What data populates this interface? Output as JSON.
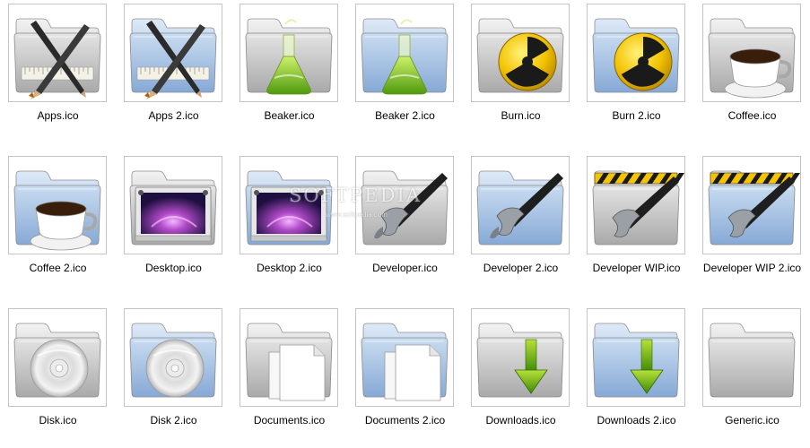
{
  "watermark": {
    "title": "SOFTPEDIA",
    "url": "www.softpedia.com"
  },
  "files": [
    {
      "label": "Apps.ico",
      "folder": "gray",
      "icon": "pencil-ruler-icon"
    },
    {
      "label": "Apps 2.ico",
      "folder": "blue",
      "icon": "pencil-ruler-icon"
    },
    {
      "label": "Beaker.ico",
      "folder": "gray",
      "icon": "beaker-icon"
    },
    {
      "label": "Beaker 2.ico",
      "folder": "blue",
      "icon": "beaker-icon"
    },
    {
      "label": "Burn.ico",
      "folder": "gray",
      "icon": "radiation-icon"
    },
    {
      "label": "Burn 2.ico",
      "folder": "blue",
      "icon": "radiation-icon"
    },
    {
      "label": "Coffee.ico",
      "folder": "gray",
      "icon": "coffee-cup-icon"
    },
    {
      "label": "Coffee 2.ico",
      "folder": "blue",
      "icon": "coffee-cup-icon"
    },
    {
      "label": "Desktop.ico",
      "folder": "gray",
      "icon": "desktop-picture-icon"
    },
    {
      "label": "Desktop 2.ico",
      "folder": "blue",
      "icon": "desktop-picture-icon"
    },
    {
      "label": "Developer.ico",
      "folder": "gray",
      "icon": "hammer-icon"
    },
    {
      "label": "Developer 2.ico",
      "folder": "blue",
      "icon": "hammer-icon"
    },
    {
      "label": "Developer WIP.ico",
      "folder": "gray",
      "icon": "hammer-wip-icon"
    },
    {
      "label": "Developer WIP 2.ico",
      "folder": "blue",
      "icon": "hammer-wip-icon"
    },
    {
      "label": "Disk.ico",
      "folder": "gray",
      "icon": "disc-icon"
    },
    {
      "label": "Disk 2.ico",
      "folder": "blue",
      "icon": "disc-icon"
    },
    {
      "label": "Documents.ico",
      "folder": "gray",
      "icon": "documents-icon"
    },
    {
      "label": "Documents 2.ico",
      "folder": "blue",
      "icon": "documents-icon"
    },
    {
      "label": "Downloads.ico",
      "folder": "gray",
      "icon": "download-arrow-icon"
    },
    {
      "label": "Downloads 2.ico",
      "folder": "blue",
      "icon": "download-arrow-icon"
    },
    {
      "label": "Generic.ico",
      "folder": "gray",
      "icon": "folder-icon"
    }
  ],
  "colors": {
    "folder_gray_top": "#dcdcdc",
    "folder_gray_bottom": "#b3b3b3",
    "folder_blue_top": "#bcd3ec",
    "folder_blue_bottom": "#8fb2dc",
    "tile_border": "#c4c4c4"
  }
}
